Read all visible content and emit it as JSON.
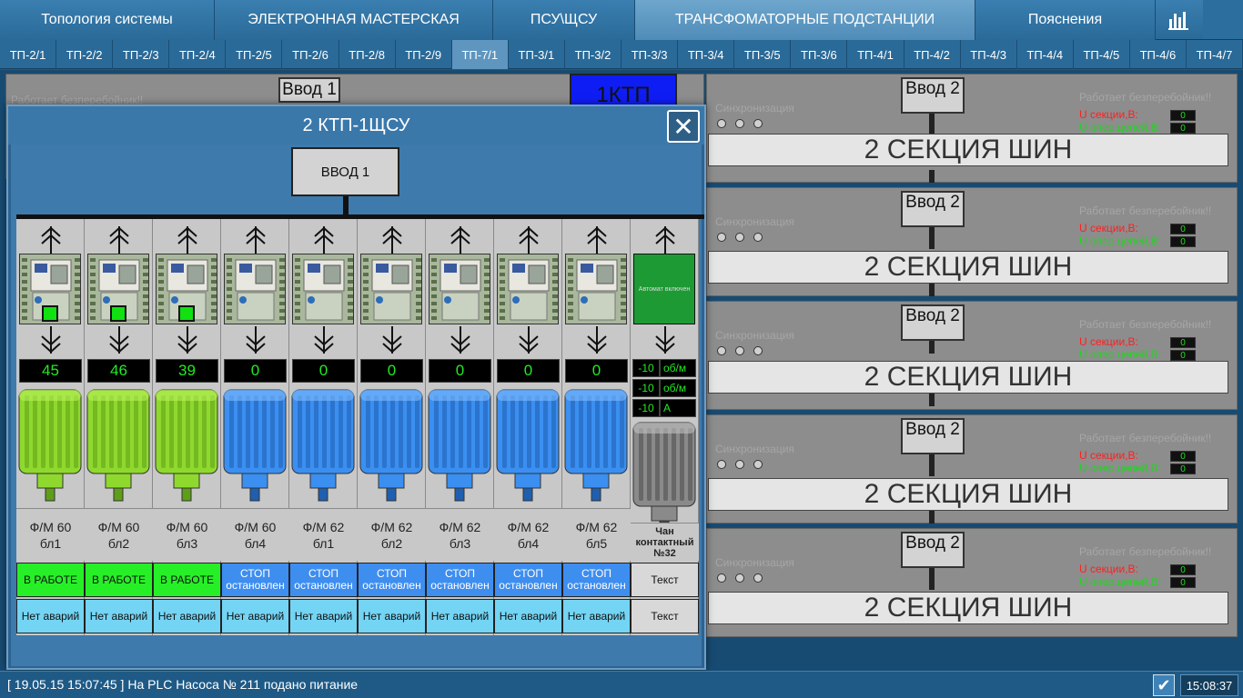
{
  "top_nav": [
    {
      "label": "Топология системы",
      "active": false
    },
    {
      "label": "ЭЛЕКТРОННАЯ МАСТЕРСКАЯ",
      "active": false
    },
    {
      "label": "ПСУ\\ЩСУ",
      "active": false
    },
    {
      "label": "ТРАНСФОМАТОРНЫЕ ПОДСТАНЦИИ",
      "active": true
    },
    {
      "label": "Пояснения",
      "active": false
    }
  ],
  "top_nav_icon": "bar-chart-icon",
  "tp_tabs": [
    {
      "label": "ТП-2/1"
    },
    {
      "label": "ТП-2/2"
    },
    {
      "label": "ТП-2/3"
    },
    {
      "label": "ТП-2/4"
    },
    {
      "label": "ТП-2/5"
    },
    {
      "label": "ТП-2/6"
    },
    {
      "label": "ТП-2/8"
    },
    {
      "label": "ТП-2/9"
    },
    {
      "label": "ТП-7/1",
      "active": true
    },
    {
      "label": "ТП-3/1"
    },
    {
      "label": "ТП-3/2"
    },
    {
      "label": "ТП-3/3"
    },
    {
      "label": "ТП-3/4"
    },
    {
      "label": "ТП-3/5"
    },
    {
      "label": "ТП-3/6"
    },
    {
      "label": "ТП-4/1"
    },
    {
      "label": "ТП-4/2"
    },
    {
      "label": "ТП-4/3"
    },
    {
      "label": "ТП-4/4"
    },
    {
      "label": "ТП-4/5"
    },
    {
      "label": "ТП-4/6"
    },
    {
      "label": "ТП-4/7"
    }
  ],
  "background": {
    "left_vvod": "Ввод 1",
    "left_ghost": "Работает безперебойник!!",
    "ktp_label": "1КТП",
    "panels": [
      {
        "vvod": "Ввод 2",
        "bus": "2 СЕКЦИЯ ШИН",
        "sync": "Синхронизация",
        "ups": "Работает безперебойник!!",
        "u_sec": "U секции,В:",
        "u_op": "U опер.цепей,В:",
        "v1": "0",
        "v2": "0"
      },
      {
        "vvod": "Ввод 2",
        "bus": "2 СЕКЦИЯ ШИН",
        "sync": "Синхронизация",
        "ups": "Работает безперебойник!!",
        "u_sec": "U секции,В:",
        "u_op": "U опер.цепей,В:",
        "v1": "0",
        "v2": "0"
      },
      {
        "vvod": "Ввод 2",
        "bus": "2 СЕКЦИЯ ШИН",
        "sync": "Синхронизация",
        "ups": "Работает безперебойник!!",
        "u_sec": "U секции,В:",
        "u_op": "U опер.цепей,В:",
        "v1": "0",
        "v2": "0"
      },
      {
        "vvod": "Ввод 2",
        "bus": "2  СЕКЦИЯ ШИН",
        "sync": "Синхронизация",
        "ups": "Работает безперебойник!!",
        "u_sec": "U секции,В:",
        "u_op": "U опер.цепей,В:",
        "v1": "0",
        "v2": "0"
      },
      {
        "vvod": "Ввод 2",
        "bus": "2  СЕКЦИЯ ШИН",
        "sync": "Синхронизация",
        "ups": "Работает безперебойник!!",
        "u_sec": "U секции,В:",
        "u_op": "U опер.цепей,В:",
        "v1": "0",
        "v2": "0"
      }
    ]
  },
  "modal": {
    "title": "2 КТП-1ЩСУ",
    "close_icon": "close-icon",
    "vvod": "ВВОД 1",
    "columns": [
      {
        "value": "45",
        "motor": "green",
        "label1": "Ф/М 60",
        "label2": "бл1",
        "status1": "В РАБОТЕ",
        "status2": "",
        "status_type": "run",
        "alarm": "Нет аварий",
        "indicator": true
      },
      {
        "value": "46",
        "motor": "green",
        "label1": "Ф/М 60",
        "label2": "бл2",
        "status1": "В РАБОТЕ",
        "status2": "",
        "status_type": "run",
        "alarm": "Нет аварий",
        "indicator": true
      },
      {
        "value": "39",
        "motor": "green",
        "label1": "Ф/М 60",
        "label2": "бл3",
        "status1": "В РАБОТЕ",
        "status2": "",
        "status_type": "run",
        "alarm": "Нет аварий",
        "indicator": true
      },
      {
        "value": "0",
        "motor": "blue",
        "label1": "Ф/М 60",
        "label2": "бл4",
        "status1": "СТОП",
        "status2": "остановлен",
        "status_type": "stop",
        "alarm": "Нет аварий",
        "indicator": false
      },
      {
        "value": "0",
        "motor": "blue",
        "label1": "Ф/М 62",
        "label2": "бл1",
        "status1": "СТОП",
        "status2": "остановлен",
        "status_type": "stop",
        "alarm": "Нет аварий",
        "indicator": false
      },
      {
        "value": "0",
        "motor": "blue",
        "label1": "Ф/М 62",
        "label2": "бл2",
        "status1": "СТОП",
        "status2": "остановлен",
        "status_type": "stop",
        "alarm": "Нет аварий",
        "indicator": false
      },
      {
        "value": "0",
        "motor": "blue",
        "label1": "Ф/М 62",
        "label2": "бл3",
        "status1": "СТОП",
        "status2": "остановлен",
        "status_type": "stop",
        "alarm": "Нет аварий",
        "indicator": false
      },
      {
        "value": "0",
        "motor": "blue",
        "label1": "Ф/М 62",
        "label2": "бл4",
        "status1": "СТОП",
        "status2": "остановлен",
        "status_type": "stop",
        "alarm": "Нет аварий",
        "indicator": false
      },
      {
        "value": "0",
        "motor": "blue",
        "label1": "Ф/М 62",
        "label2": "бл5",
        "status1": "СТОП",
        "status2": "остановлен",
        "status_type": "stop",
        "alarm": "Нет аварий",
        "indicator": false
      }
    ],
    "last": {
      "box_label": "Автомат включен",
      "readings": [
        {
          "value": "-10",
          "unit": "об/м"
        },
        {
          "value": "-10",
          "unit": "об/м"
        },
        {
          "value": "-10",
          "unit": "А"
        }
      ],
      "label1": "Чан",
      "label2": "контактный",
      "label3": "№32",
      "status": "Текст",
      "alarm": "Текст"
    }
  },
  "status_bar": {
    "message": "[ 19.05.15 15:07:45 ] На PLC  Насоса № 211 подано питание",
    "check_icon": "check-icon",
    "clock": "15:08:37"
  },
  "colors": {
    "run_green": "#27ef27",
    "stop_blue": "#3e8ef0",
    "alarm_cyan": "#74d4f4",
    "ktp_blue": "#0f1df5"
  }
}
